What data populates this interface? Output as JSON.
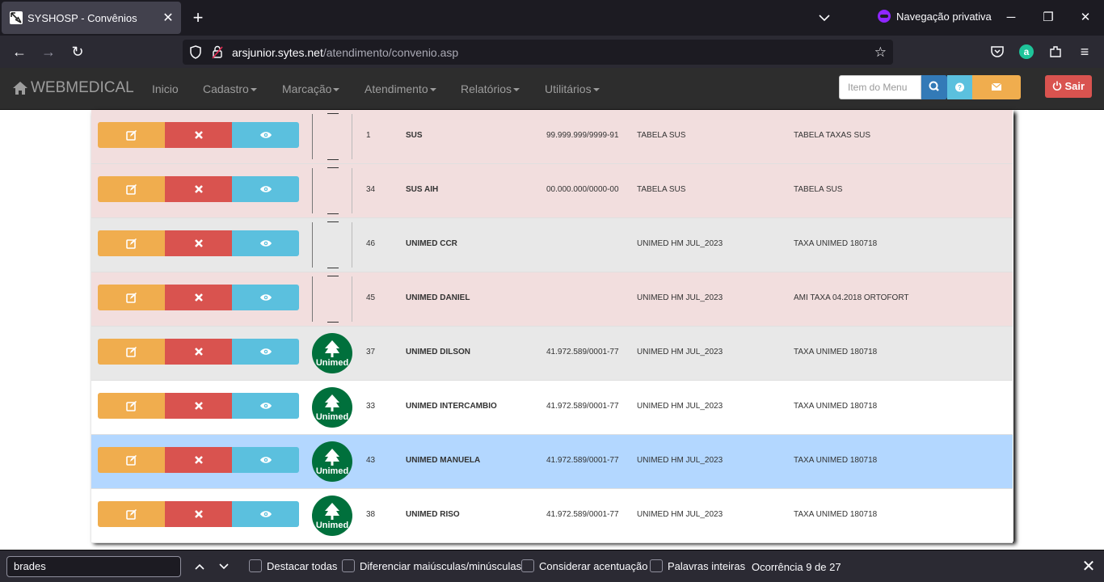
{
  "browser": {
    "tab_title": "SYSHOSP - Convênios",
    "private_label": "Navegação privativa",
    "url_domain": "arsjunior.sytes.net",
    "url_path": "/atendimento/convenio.asp"
  },
  "app": {
    "brand": "WEBMEDICAL",
    "menu": [
      "Inicio",
      "Cadastro",
      "Marcação",
      "Atendimento",
      "Relatórios",
      "Utilitários"
    ],
    "search_placeholder": "Item do Menu",
    "logout_label": "Sair"
  },
  "table": {
    "rows": [
      {
        "code": "1",
        "name": "SUS",
        "cnpj": "99.999.999/9999-91",
        "tabela": "TABELA SUS",
        "taxa": "TABELA TAXAS SUS",
        "logo": false,
        "tone": "pink"
      },
      {
        "code": "34",
        "name": "SUS AIH",
        "cnpj": "00.000.000/0000-00",
        "tabela": "TABELA SUS",
        "taxa": "TABELA SUS",
        "logo": false,
        "tone": "pink"
      },
      {
        "code": "46",
        "name": "UNIMED CCR",
        "cnpj": "",
        "tabela": "UNIMED HM JUL_2023",
        "taxa": "TAXA UNIMED 180718",
        "logo": false,
        "tone": "grey"
      },
      {
        "code": "45",
        "name": "UNIMED DANIEL",
        "cnpj": "",
        "tabela": "UNIMED HM JUL_2023",
        "taxa": "AMI TAXA 04.2018 ORTOFORT",
        "logo": false,
        "tone": "pink"
      },
      {
        "code": "37",
        "name": "UNIMED DILSON",
        "cnpj": "41.972.589/0001-77",
        "tabela": "UNIMED HM JUL_2023",
        "taxa": "TAXA UNIMED 180718",
        "logo": true,
        "tone": "grey"
      },
      {
        "code": "33",
        "name": "UNIMED INTERCAMBIO",
        "cnpj": "41.972.589/0001-77",
        "tabela": "UNIMED HM JUL_2023",
        "taxa": "TAXA UNIMED 180718",
        "logo": true,
        "tone": "white"
      },
      {
        "code": "43",
        "name": "UNIMED MANUELA",
        "cnpj": "41.972.589/0001-77",
        "tabela": "UNIMED HM JUL_2023",
        "taxa": "TAXA UNIMED 180718",
        "logo": true,
        "tone": "blue"
      },
      {
        "code": "38",
        "name": "UNIMED RISO",
        "cnpj": "41.972.589/0001-77",
        "tabela": "UNIMED HM JUL_2023",
        "taxa": "TAXA UNIMED 180718",
        "logo": true,
        "tone": "white"
      }
    ],
    "logo_text": "Unimed"
  },
  "findbar": {
    "query": "brades",
    "options": [
      "Destacar todas",
      "Diferenciar maiúsculas/minúsculas",
      "Considerar acentuação",
      "Palavras inteiras"
    ],
    "status": "Ocorrência 9 de 27"
  },
  "colors": {
    "edit": "#f0ad4e",
    "delete": "#d9534f",
    "view": "#5bc0de",
    "unimed_green": "#00703c"
  }
}
